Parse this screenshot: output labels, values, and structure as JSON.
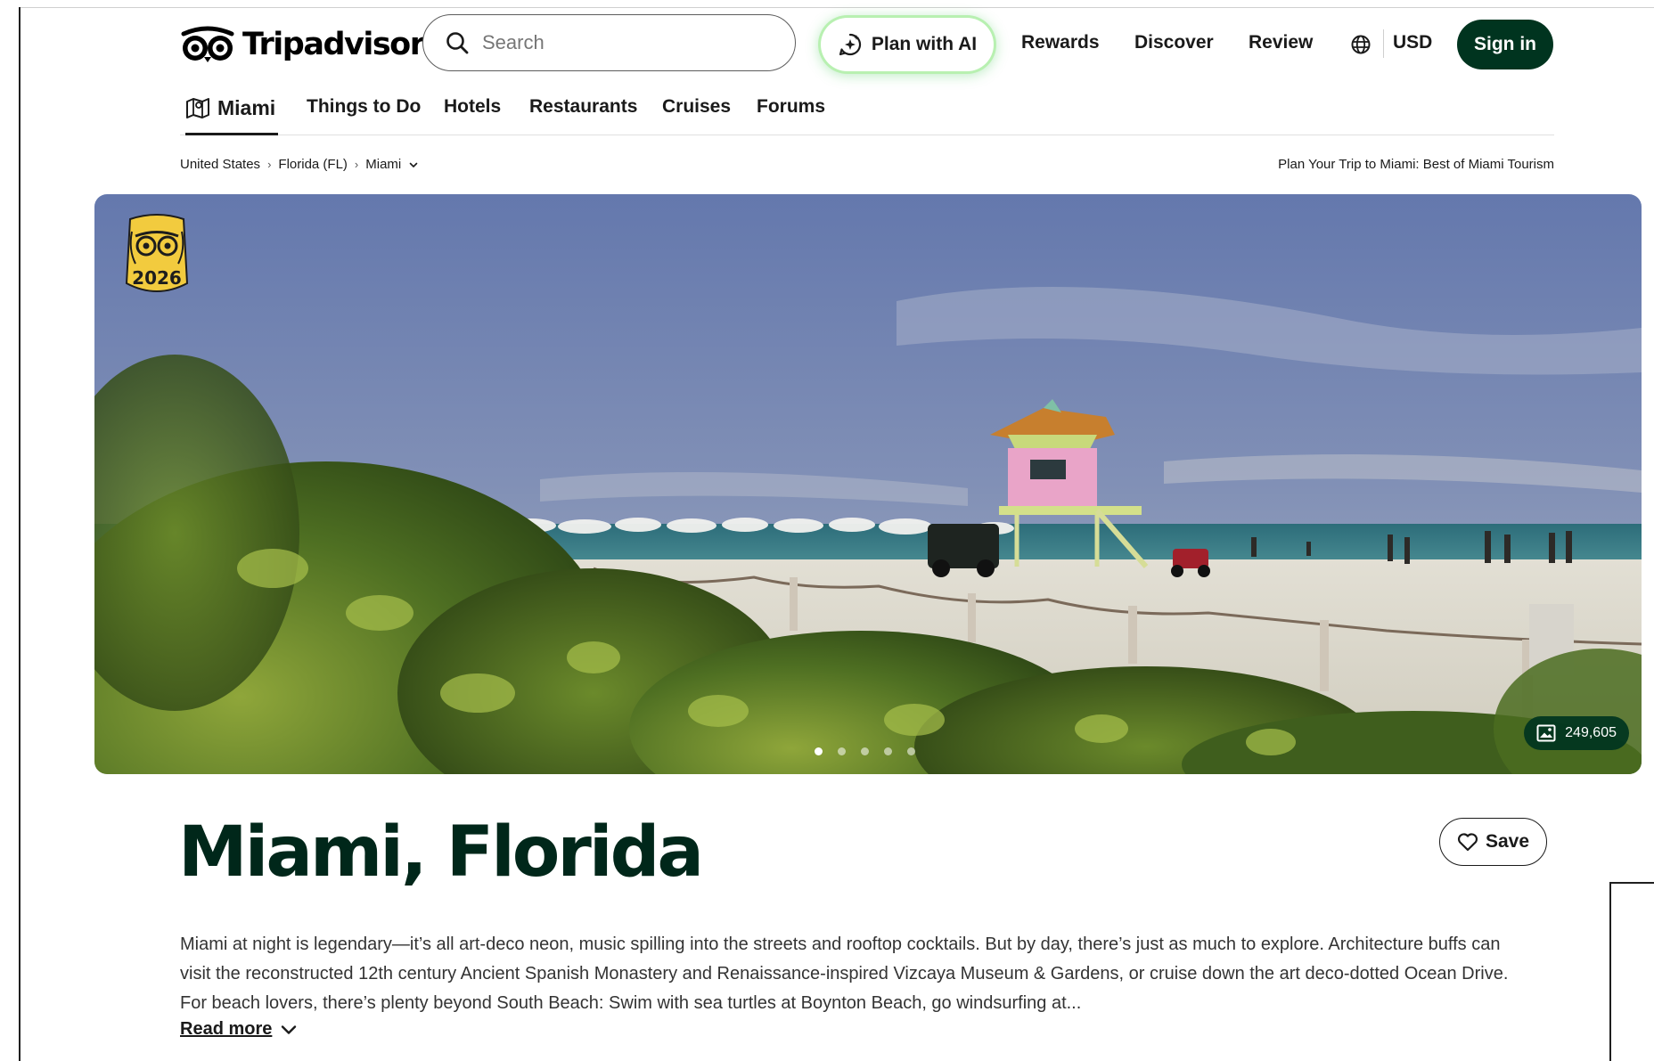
{
  "header": {
    "brand": "Tripadvisor",
    "search_placeholder": "Search",
    "plan_ai_label": "Plan with AI",
    "nav": {
      "rewards": "Rewards",
      "discover": "Discover",
      "review": "Review",
      "currency": "USD"
    },
    "signin_label": "Sign in"
  },
  "subnav": {
    "active": "Miami",
    "items": [
      "Things to Do",
      "Hotels",
      "Restaurants",
      "Cruises",
      "Forums"
    ]
  },
  "breadcrumb": {
    "items": [
      "United States",
      "Florida (FL)",
      "Miami"
    ],
    "tourism_link": "Plan Your Trip to Miami: Best of Miami Tourism"
  },
  "hero": {
    "award_year": "2026",
    "photo_count": "249,605",
    "slide_count": 5,
    "active_slide": 1
  },
  "page": {
    "title": "Miami, Florida",
    "save_label": "Save",
    "description": "Miami at night is legendary—it’s all art-deco neon, music spilling into the streets and rooftop cocktails. But by day, there’s just as much to explore. Architecture buffs can visit the reconstructed 12th century Ancient Spanish Monastery and Renaissance-inspired Vizcaya Museum & Gardens, or cruise down the art deco-dotted Ocean Drive. For beach lovers, there’s plenty beyond South Beach: Swim with sea turtles at Boynton Beach, go windsurfing at...",
    "read_more": "Read more"
  },
  "colors": {
    "brand_dark": "#00341f",
    "title_green": "#00271a",
    "ai_glow": "#b8f0b1"
  },
  "icons": [
    "owl-logo-icon",
    "search-icon",
    "sparkle-icon",
    "globe-icon",
    "map-icon",
    "chevron-down-icon",
    "award-badge-icon",
    "image-icon",
    "heart-icon"
  ]
}
